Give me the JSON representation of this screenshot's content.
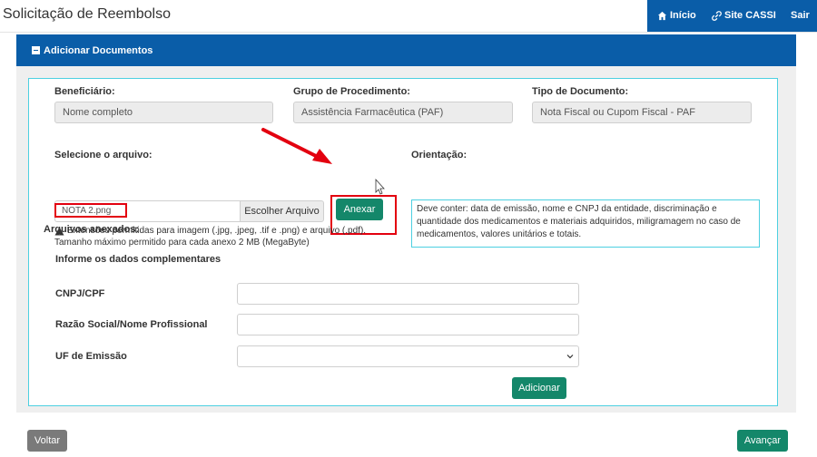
{
  "app": {
    "title": "Solicitação de Reembolso"
  },
  "nav": [
    {
      "label": "Início",
      "icon": "home-icon"
    },
    {
      "label": "Site CASSI",
      "icon": "link-icon"
    },
    {
      "label": "Sair"
    }
  ],
  "panel": {
    "title": "Adicionar Documentos",
    "beneficiario": {
      "label": "Beneficiário:",
      "value": "Nome completo"
    },
    "grupo": {
      "label": "Grupo de Procedimento:",
      "value": "Assistência Farmacêutica (PAF)"
    },
    "tipo": {
      "label": "Tipo de Documento:",
      "value": "Nota Fiscal ou Cupom Fiscal - PAF"
    },
    "file": {
      "label": "Selecione o arquivo:",
      "value": "NOTA 2.png",
      "choose_label": "Escolher Arquivo",
      "attach_label": "Anexar",
      "help_types": "Extensões permitidas para imagem (.jpg, .jpeg, .tif e .png) e arquivo (.pdf).",
      "help_size": "Tamanho máximo permitido para cada anexo 2 MB (MegaByte)"
    },
    "orientation": {
      "label": "Orientação:",
      "text": "Deve conter: data de emissão, nome e CNPJ da entidade, discriminação e quantidade dos medicamentos e materiais adquiridos, miligramagem no caso de medicamentos, valores unitários e totais."
    },
    "attachments_label": "Arquivos anexados:",
    "complementary": {
      "title": "Informe os dados complementares",
      "cnpj_label": "CNPJ/CPF",
      "razao_label": "Razão Social/Nome Profissional",
      "uf_label": "UF de Emissão",
      "add_label": "Adicionar"
    }
  },
  "footer": {
    "back_label": "Voltar",
    "next_label": "Avançar"
  },
  "colors": {
    "primary": "#0a5da8",
    "success": "#14876a",
    "highlight": "#e3000f",
    "accent_border": "#4dd0e1"
  }
}
